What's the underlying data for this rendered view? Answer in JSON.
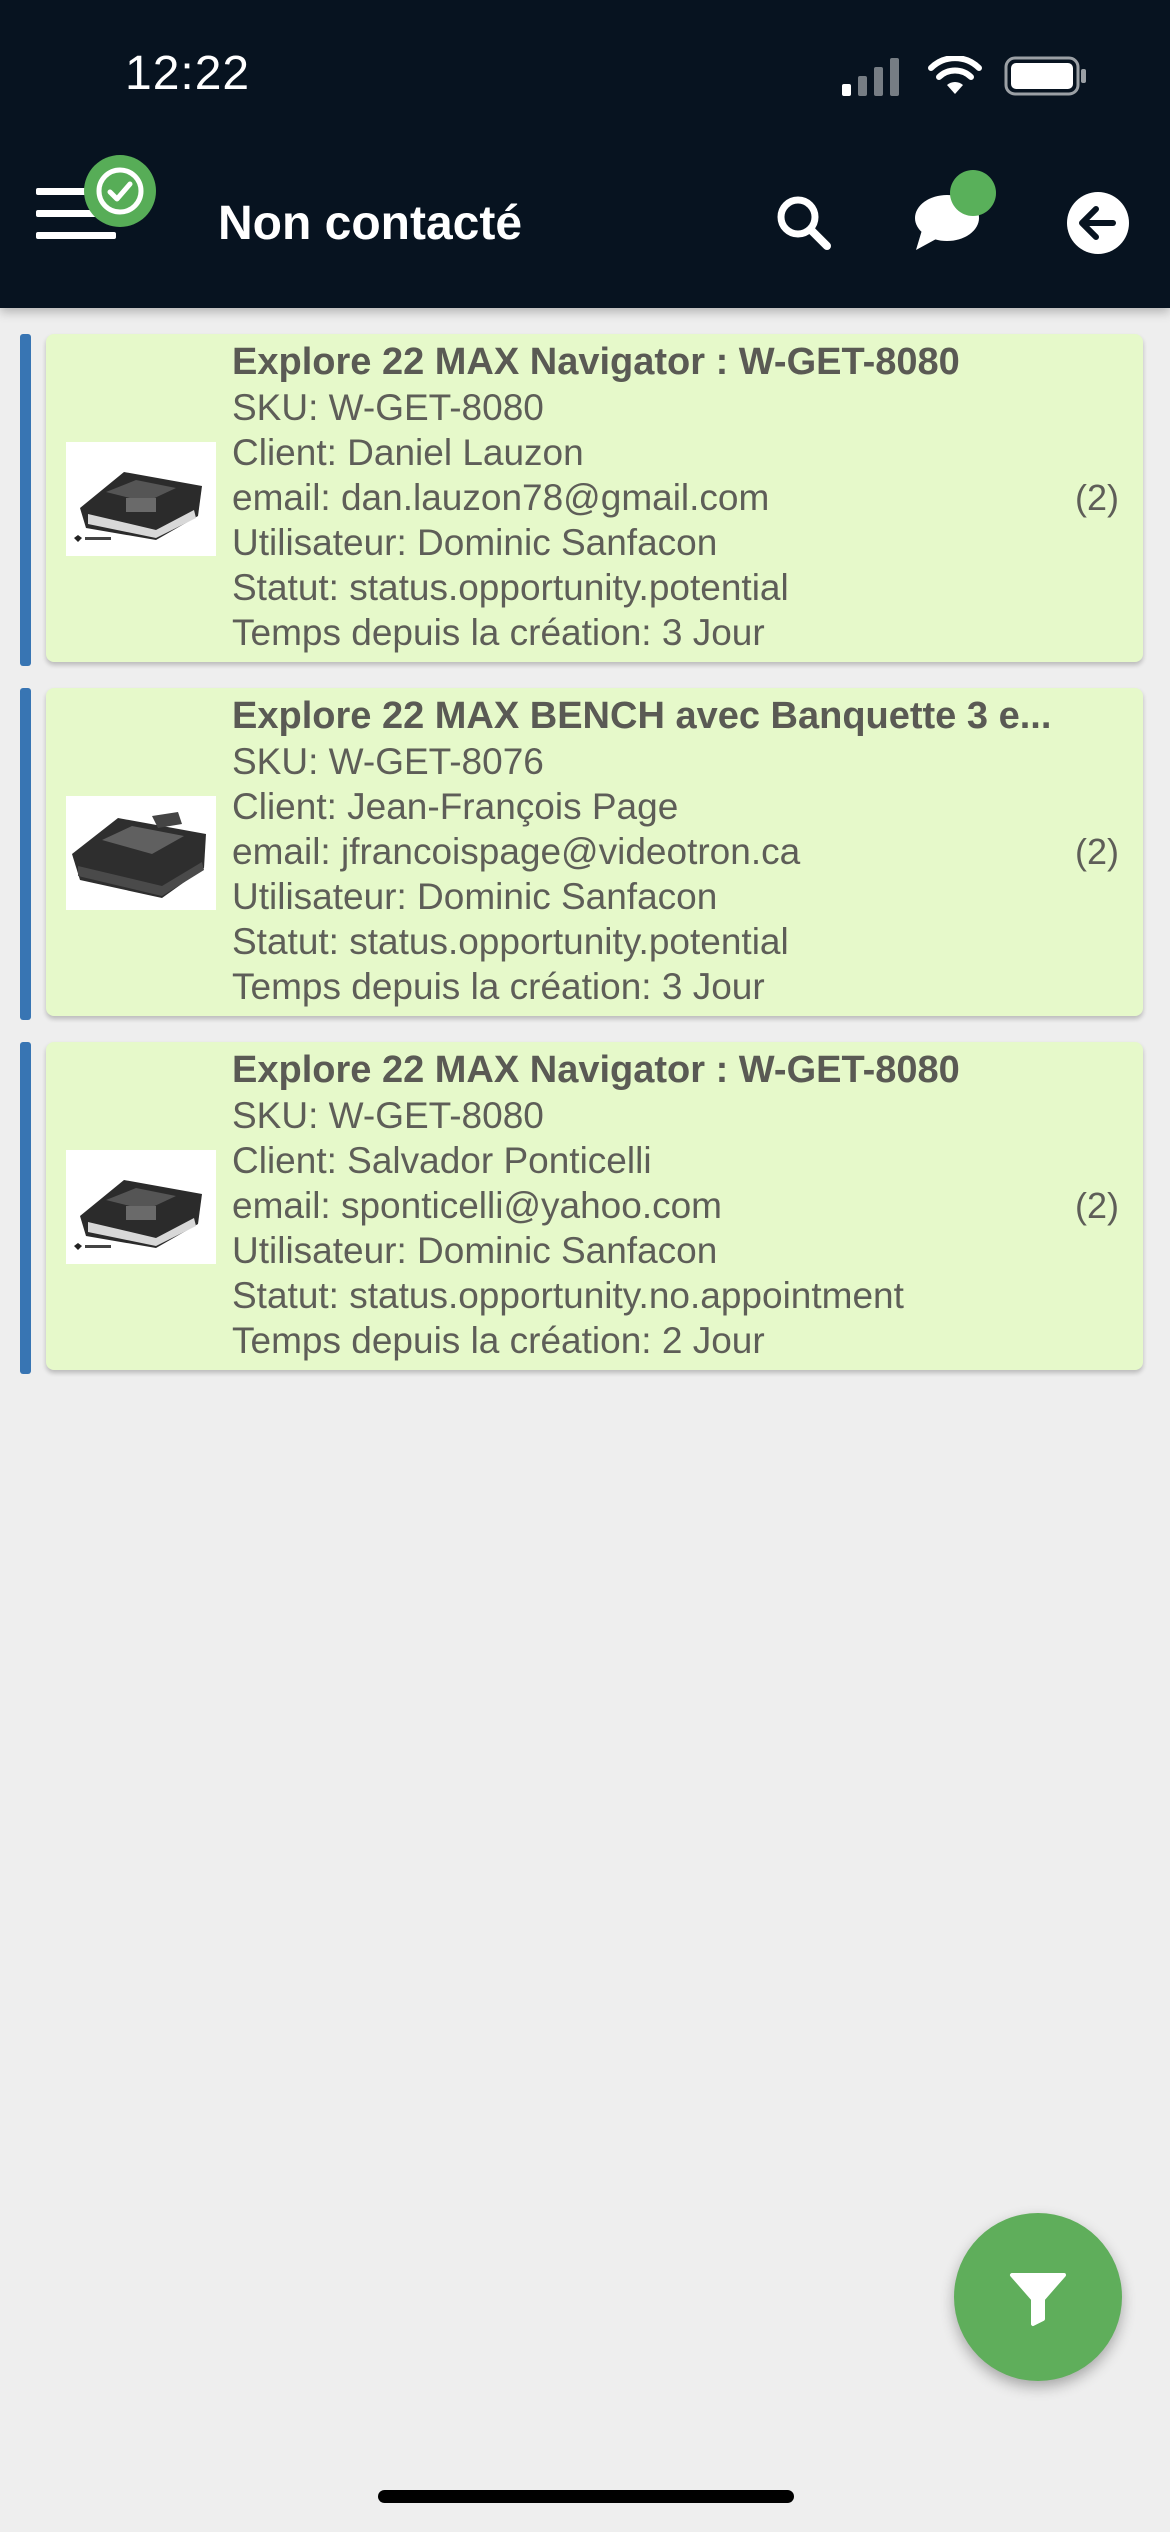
{
  "status_bar": {
    "time": "12:22",
    "icons": [
      "cellular-signal-icon",
      "wifi-icon",
      "battery-icon"
    ]
  },
  "app_bar": {
    "title": "Non contacté",
    "icons": [
      "menu-icon",
      "sync-check-icon",
      "search-icon",
      "chat-icon",
      "back-arrow-icon"
    ]
  },
  "colors": {
    "header_bg": "#071320",
    "card_bg": "#e6f9ca",
    "accent_bar": "#3875b3",
    "badge_green": "#57ad57",
    "fab_green": "#5fae5b",
    "page_bg": "#eeeeee"
  },
  "opportunities": [
    {
      "title": "Explore 22 MAX Navigator : W-GET-8080",
      "sku": "SKU: W-GET-8080",
      "client": "Client: Daniel Lauzon",
      "email": "email: dan.lauzon78@gmail.com",
      "user": "Utilisateur: Dominic Sanfacon",
      "status": "Statut: status.opportunity.potential",
      "age": "Temps depuis la création: 3 Jour",
      "count": "(2)",
      "thumbnail": "boat-image"
    },
    {
      "title": "Explore 22 MAX BENCH avec Banquette 3 e...",
      "sku": "SKU: W-GET-8076",
      "client": "Client: Jean-François Page",
      "email": "email: jfrancoispage@videotron.ca",
      "user": "Utilisateur: Dominic Sanfacon",
      "status": "Statut: status.opportunity.potential",
      "age": "Temps depuis la création: 3 Jour",
      "count": "(2)",
      "thumbnail": "boat-image"
    },
    {
      "title": "Explore 22 MAX Navigator : W-GET-8080",
      "sku": "SKU: W-GET-8080",
      "client": "Client: Salvador Ponticelli",
      "email": "email: sponticelli@yahoo.com",
      "user": "Utilisateur: Dominic Sanfacon",
      "status": "Statut: status.opportunity.no.appointment",
      "age": "Temps depuis la création: 2 Jour",
      "count": "(2)",
      "thumbnail": "boat-image"
    }
  ],
  "fab": {
    "icon": "filter-icon"
  }
}
